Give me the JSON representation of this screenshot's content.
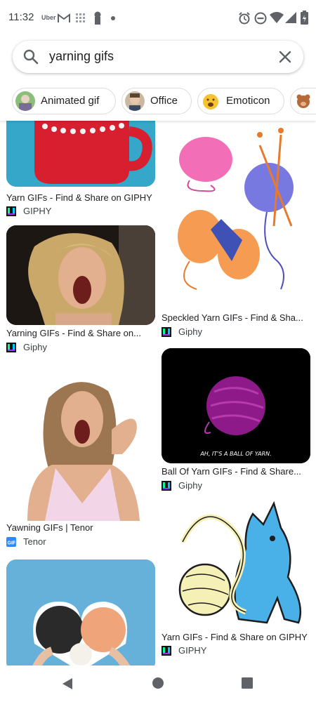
{
  "status": {
    "time": "11:32",
    "uber": "Uber"
  },
  "search": {
    "query": "yarning gifs"
  },
  "chips": [
    {
      "label": "Animated gif"
    },
    {
      "label": "Office"
    },
    {
      "label": "Emoticon"
    }
  ],
  "results": {
    "left": [
      {
        "title": "Yarn GIFs - Find & Share on GIPHY",
        "source": "GIPHY"
      },
      {
        "title": "Yarning GIFs - Find & Share on...",
        "source": "Giphy"
      },
      {
        "title": "Yawning GIFs | Tenor",
        "source": "Tenor"
      }
    ],
    "right": [
      {
        "title": "Speckled Yarn GIFs - Find & Sha...",
        "source": "Giphy"
      },
      {
        "title": "Ball Of Yarn GIFs - Find & Share...",
        "source": "Giphy",
        "caption": "AH, IT'S A BALL OF YARN."
      },
      {
        "title": "Yarn GIFs - Find & Share on GIPHY",
        "source": "GIPHY"
      }
    ]
  },
  "colors": {
    "accent": "#4285f4",
    "giphy": "#00ff99",
    "tenor": "#2f8bfd"
  },
  "icons": [
    "search-icon",
    "close-icon",
    "back-icon",
    "home-icon",
    "recents-icon"
  ]
}
